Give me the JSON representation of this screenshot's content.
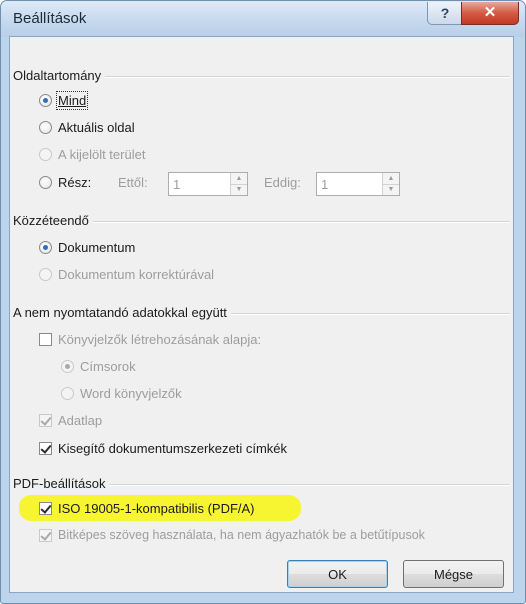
{
  "window": {
    "title": "Beállítások",
    "help_label": "?",
    "close_label": "✕"
  },
  "page_range": {
    "group_label": "Oldaltartomány",
    "all_label": "Mind",
    "current_label": "Aktuális oldal",
    "selection_label": "A kijelölt terület",
    "part_label": "Rész:",
    "from_label": "Ettől:",
    "from_value": "1",
    "to_label": "Eddig:",
    "to_value": "1",
    "selected": "all"
  },
  "publish": {
    "group_label": "Közzéteendő",
    "document_label": "Dokumentum",
    "markup_label": "Dokumentum korrektúrával",
    "selected": "document"
  },
  "non_printing": {
    "group_label": "A nem nyomtatandó adatokkal együtt",
    "bookmarks_label": "Könyvjelzők létrehozásának alapja:",
    "headings_label": "Címsorok",
    "word_bookmarks_label": "Word könyvjelzők",
    "properties_label": "Adatlap",
    "structure_tags_label": "Kisegítő dokumentumszerkezeti címkék",
    "bookmarks_checked": false,
    "properties_checked": true,
    "structure_tags_checked": true
  },
  "pdf_options": {
    "group_label": "PDF-beállítások",
    "iso_label": "ISO 19005-1-kompatibilis (PDF/A)",
    "bitmap_label": "Bitképes szöveg használata, ha nem ágyazhatók be a betűtípusok",
    "iso_checked": true,
    "bitmap_checked": true,
    "highlight_color": "#f7f532"
  },
  "buttons": {
    "ok_label": "OK",
    "cancel_label": "Mégse"
  }
}
